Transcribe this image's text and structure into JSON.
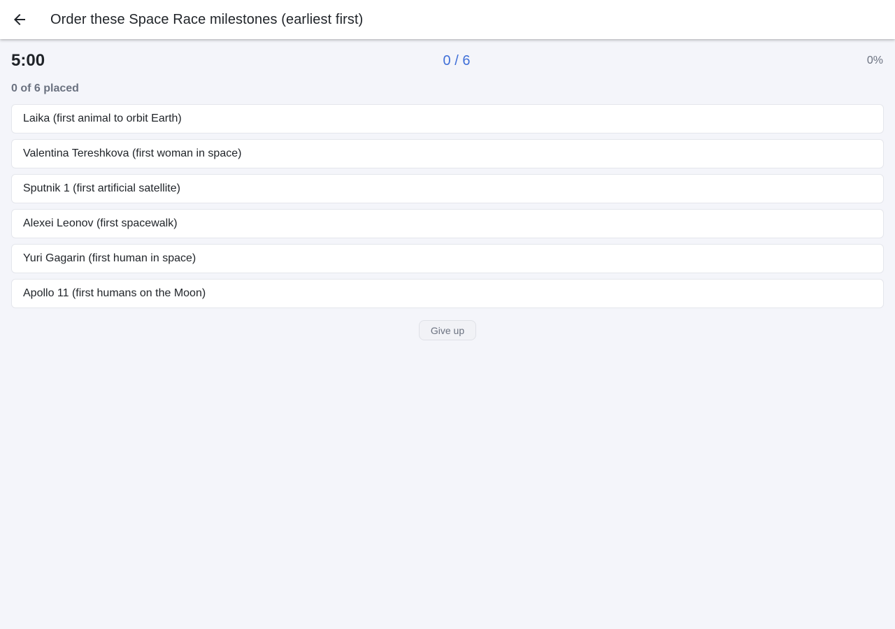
{
  "header": {
    "title": "Order these Space Race milestones (earliest first)",
    "back_icon": "arrow-left-icon"
  },
  "status": {
    "timer": "5:00",
    "score": "0 / 6",
    "percent": "0%",
    "placed": "0 of 6 placed"
  },
  "items": [
    {
      "label": "Laika (first animal to orbit Earth)"
    },
    {
      "label": "Valentina Tereshkova (first woman in space)"
    },
    {
      "label": "Sputnik 1 (first artificial satellite)"
    },
    {
      "label": "Alexei Leonov (first spacewalk)"
    },
    {
      "label": "Yuri Gagarin (first human in space)"
    },
    {
      "label": "Apollo 11 (first humans on the Moon)"
    }
  ],
  "actions": {
    "give_up_label": "Give up"
  },
  "colors": {
    "accent": "#3f6fd8",
    "background": "#f4f5fa",
    "muted_text": "#6b7280"
  }
}
